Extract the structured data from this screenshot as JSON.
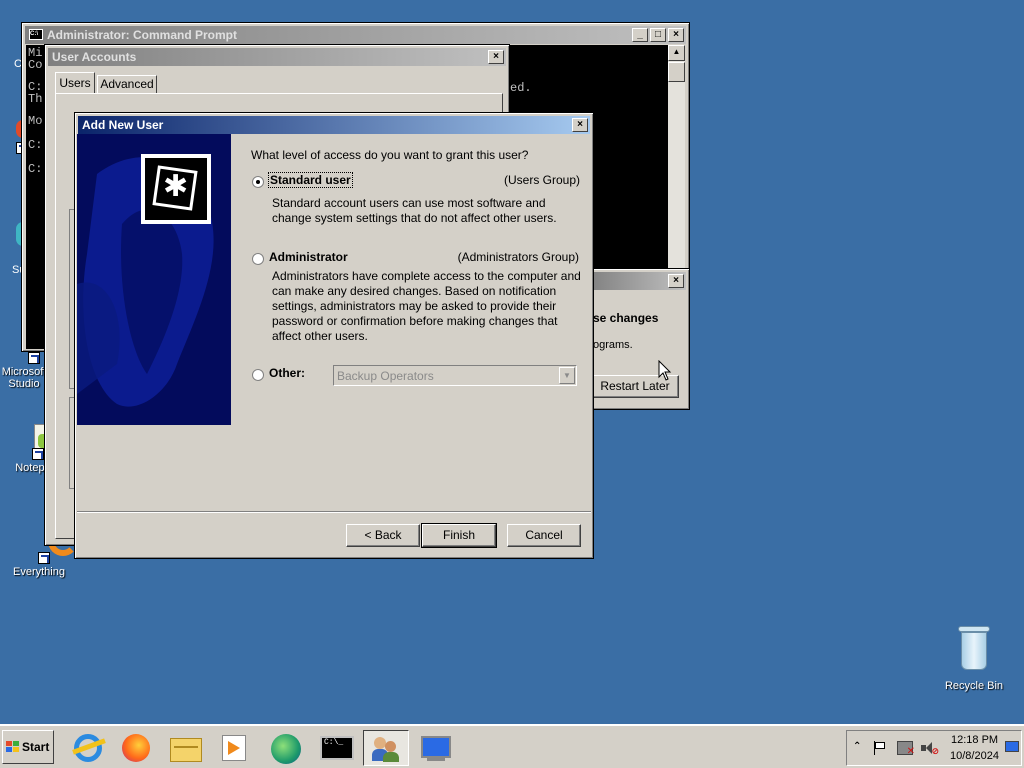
{
  "desktop": {
    "icons": [
      {
        "label": "Microsoft Studio",
        "line1": "Microsoft",
        "line2": "Studio",
        "icon": "microsoft-studio-icon"
      },
      {
        "label": "Notepad",
        "icon": "notepad-icon"
      },
      {
        "label": "Everything",
        "icon": "everything-icon"
      },
      {
        "label": "Recycle Bin",
        "icon": "recycle-bin-icon"
      }
    ],
    "partial_labels": [
      "C",
      "Su"
    ]
  },
  "cmd": {
    "title": "Administrator: Command Prompt",
    "lines": [
      "Mi",
      "Co",
      "C:",
      "Th",
      "Mo",
      "C:",
      "C:"
    ],
    "right_text": "ed."
  },
  "user_accounts": {
    "title": "User Accounts",
    "tabs": [
      "Users",
      "Advanced"
    ]
  },
  "restart_dialog": {
    "heading_fragment": "se changes",
    "body_fragment": "ograms.",
    "restart_later": "Restart Later"
  },
  "add_user": {
    "title": "Add New User",
    "question": "What level of access do you want to grant this user?",
    "options": [
      {
        "label": "Standard user",
        "group": "(Users Group)",
        "description": "Standard account users can use most software and change system settings that do not affect other users.",
        "selected": true
      },
      {
        "label": "Administrator",
        "group": "(Administrators Group)",
        "description": "Administrators have complete access to the computer and can make any desired changes. Based on notification settings, administrators may be asked to provide their password or confirmation before making changes that affect other users.",
        "selected": false
      },
      {
        "label": "Other:",
        "selected": false
      }
    ],
    "other_select_value": "Backup Operators",
    "buttons": {
      "back": "< Back",
      "finish": "Finish",
      "cancel": "Cancel"
    }
  },
  "taskbar": {
    "start": "Start",
    "clock_time": "12:18 PM",
    "clock_date": "10/8/2024",
    "apps": [
      "ie-icon",
      "firefox-icon",
      "file-explorer-icon",
      "media-player-icon",
      "edge-icon",
      "command-prompt-icon",
      "user-accounts-icon",
      "network-computer-icon"
    ]
  },
  "colors": {
    "desktop": "#3a6ea5",
    "active_title_start": "#0a246a",
    "active_title_end": "#a6caf0",
    "window_face": "#d4d0c8",
    "wizard_banner": "#04106e"
  }
}
